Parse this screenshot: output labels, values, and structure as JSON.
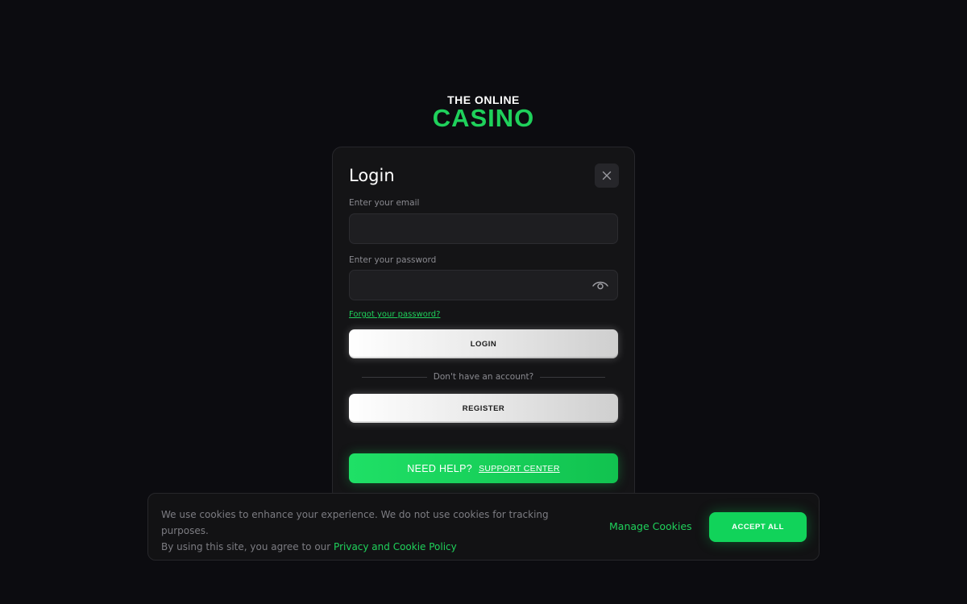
{
  "logo": {
    "line1": "THE ONLINE",
    "line2": "CASINO"
  },
  "login_modal": {
    "title": "Login",
    "close_icon": "close-icon",
    "email_label": "Enter your email",
    "email_value": "",
    "password_label": "Enter your password",
    "password_value": "",
    "show_password_icon": "eye-icon",
    "forgot_password": "Forgot your password?",
    "login_button": "LOGIN",
    "divider_text": "Don't have an account?",
    "register_button": "REGISTER",
    "help_text": "NEED HELP?",
    "help_link": "SUPPORT CENTER"
  },
  "cookie_banner": {
    "text_line1": "We use cookies to enhance your experience. We do not use cookies for tracking purposes.",
    "text_line2_prefix": "By using this site, you agree to our",
    "policy_link": "Privacy and Cookie Policy",
    "manage_button": "Manage Cookies",
    "accept_button": "ACCEPT ALL"
  },
  "colors": {
    "background": "#0c0c10",
    "accent_green": "#1fd15b",
    "modal_bg": "#141416",
    "field_bg": "#1e1e21"
  }
}
